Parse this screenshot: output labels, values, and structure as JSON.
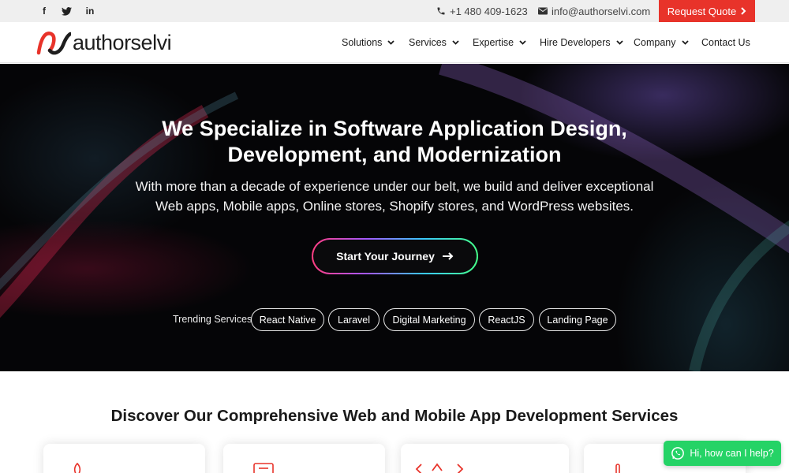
{
  "topbar": {
    "social": [
      {
        "name": "facebook-icon",
        "glyph": "f"
      },
      {
        "name": "twitter-icon",
        "glyph": "t"
      },
      {
        "name": "linkedin-icon",
        "glyph": "in"
      }
    ],
    "phone": "+1 480 409-1623",
    "email": "info@authorselvi.com",
    "quote_label": "Request Quote"
  },
  "brand": {
    "logo_text": "authorselvi",
    "accent": "#e8332a"
  },
  "nav": {
    "items": [
      {
        "label": "Solutions"
      },
      {
        "label": "Services"
      },
      {
        "label": "Expertise"
      },
      {
        "label": "Hire Developers"
      },
      {
        "label": "Company"
      },
      {
        "label": "Contact Us"
      }
    ]
  },
  "hero": {
    "title_line1": "We Specialize in Software Application Design,",
    "title_line2": "Development, and Modernization",
    "subtitle_line1": "With more than a decade of experience under our belt, we build and deliver exceptional",
    "subtitle_line2": "Web apps, Mobile apps, Online stores, Shopify stores, and WordPress websites.",
    "cta_label": "Start Your Journey",
    "trending_label": "Trending Services",
    "trending": [
      "React Native",
      "Laravel",
      "Digital Marketing",
      "ReactJS",
      "Landing Page"
    ]
  },
  "services": {
    "title": "Discover Our Comprehensive Web and Mobile App Development Services"
  },
  "whatsapp": {
    "label": "Hi, how can I help?",
    "color": "#25d366"
  }
}
